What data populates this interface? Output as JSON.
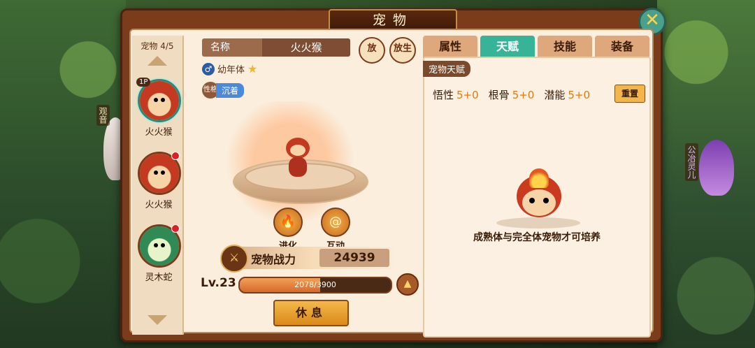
{
  "scene": {
    "npc_left": "观音",
    "npc_right": "公冶灵儿"
  },
  "panel": {
    "title": "宠物",
    "close_icon": "close-icon"
  },
  "sidebar": {
    "header": "宠物 4/5",
    "pets": [
      {
        "name": "火火猴",
        "badge": "1P",
        "selected": true
      },
      {
        "name": "火火猴",
        "badge": "",
        "reddot": true
      },
      {
        "name": "灵木蛇",
        "badge": "",
        "reddot": true
      }
    ]
  },
  "pet_info": {
    "name_label": "名称",
    "name_value": "火火猴",
    "stage": "幼年体",
    "gender_icon": "male-icon",
    "trait_label": "性格",
    "trait_value": "沉着",
    "btn_top1": "放",
    "btn_top2": "放生",
    "evolve_label": "进化",
    "interact_label": "互动",
    "power_label": "宠物战力",
    "power_value": "24939",
    "level": "Lv.23",
    "xp_text": "2078/3900",
    "xp_fraction": 0.533,
    "rest_label": "休息"
  },
  "tabs": [
    {
      "label": "属性",
      "active": false
    },
    {
      "label": "天赋",
      "active": true
    },
    {
      "label": "技能",
      "active": false
    },
    {
      "label": "装备",
      "active": false
    }
  ],
  "talent": {
    "section_title": "宠物天赋",
    "stats": [
      {
        "name": "悟性",
        "value": "5+0"
      },
      {
        "name": "根骨",
        "value": "5+0"
      },
      {
        "name": "潜能",
        "value": "5+0"
      }
    ],
    "reset_label": "重置",
    "hint": "成熟体与完全体宠物才可培养"
  }
}
